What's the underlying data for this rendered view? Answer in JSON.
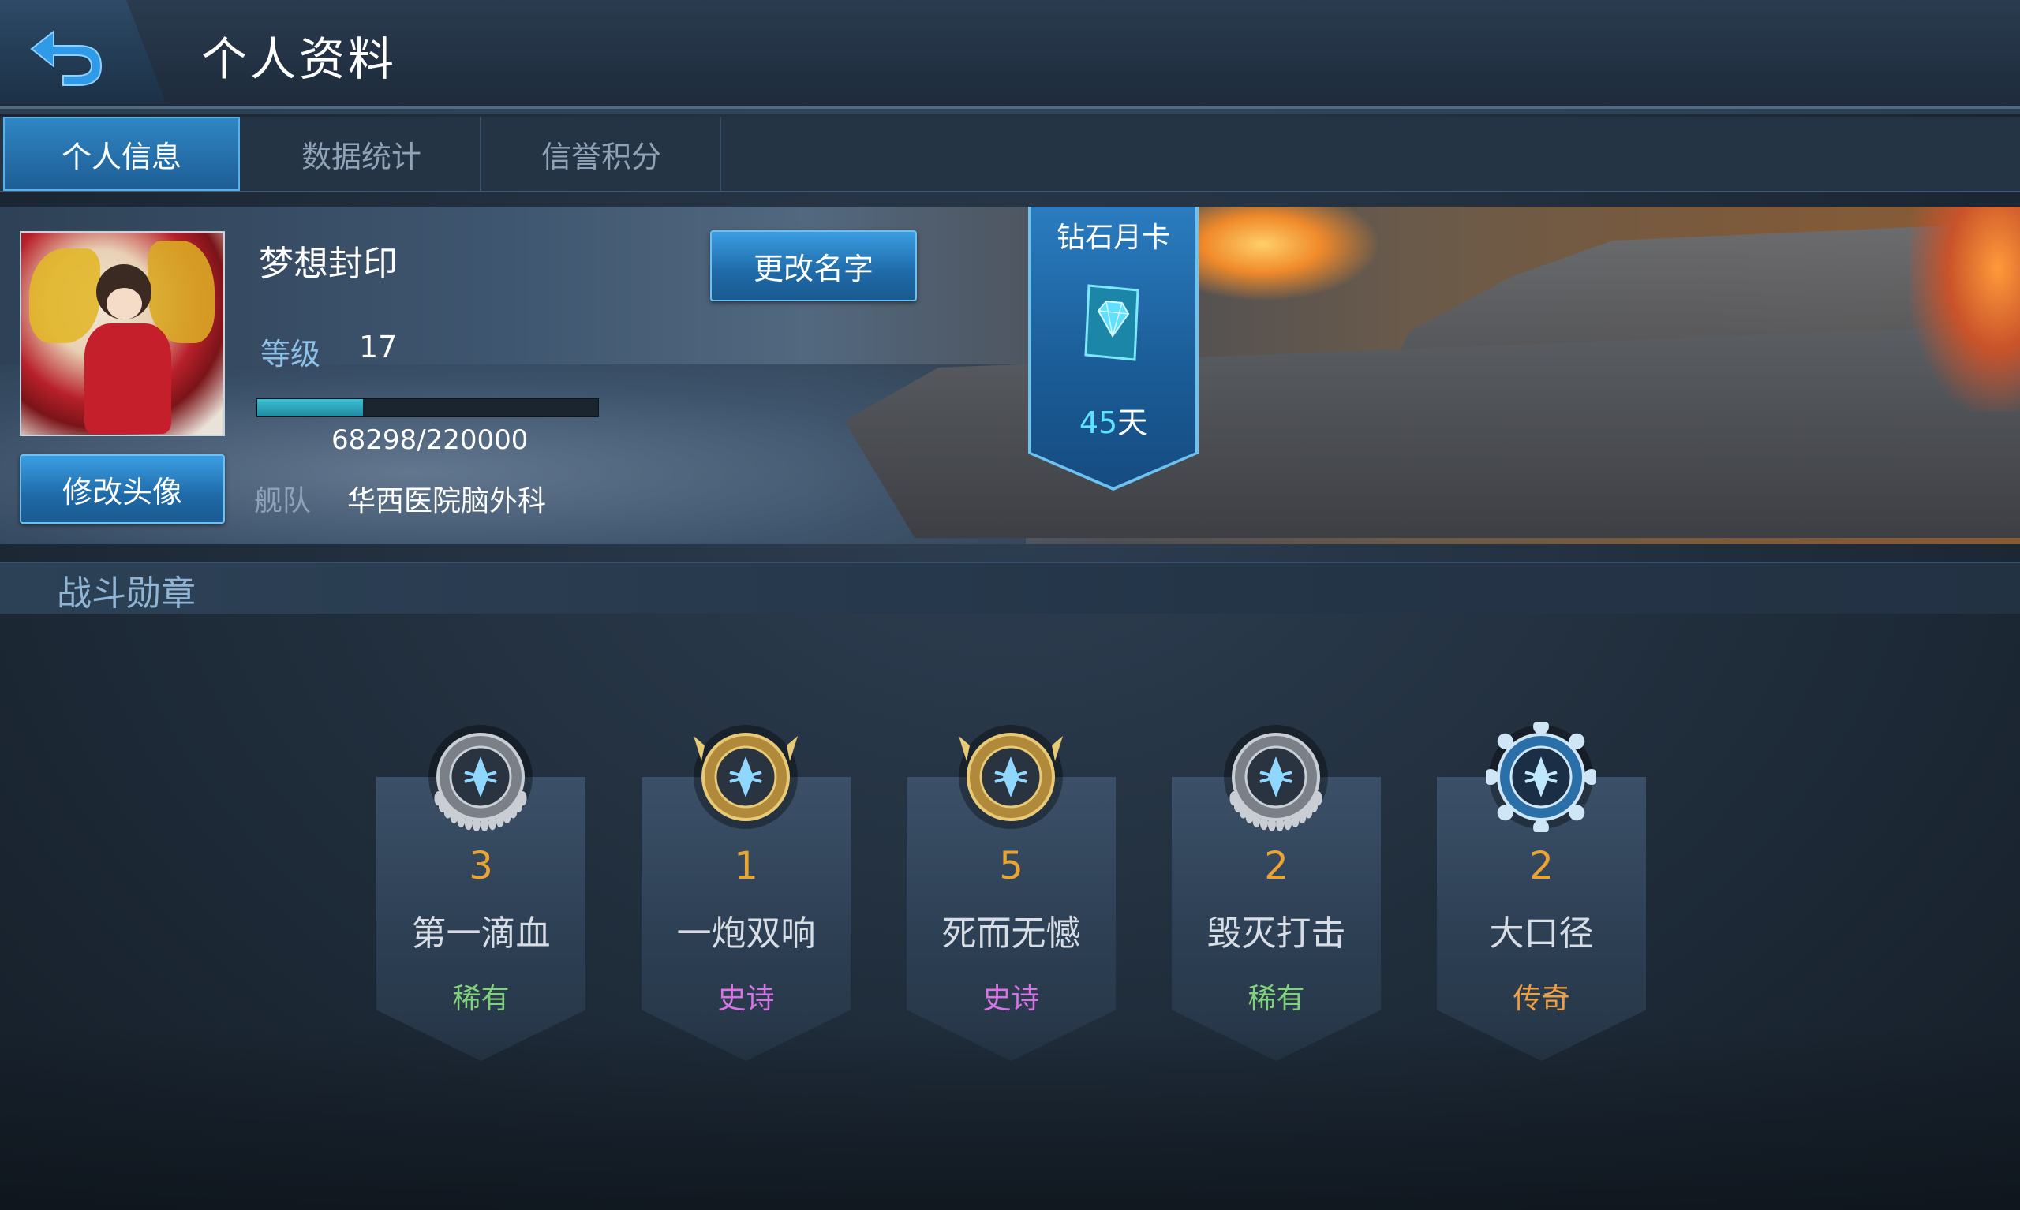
{
  "header": {
    "title": "个人资料",
    "back_icon": "back-arrow-icon"
  },
  "tabs": [
    {
      "label": "个人信息",
      "active": true
    },
    {
      "label": "数据统计",
      "active": false
    },
    {
      "label": "信誉积分",
      "active": false
    }
  ],
  "profile": {
    "username": "梦想封印",
    "rename_label": "更改名字",
    "edit_avatar_label": "修改头像",
    "level_label": "等级",
    "level": "17",
    "xp_text": "68298/220000",
    "xp_fraction": 0.31,
    "fleet_label": "舰队",
    "fleet_name": "华西医院脑外科"
  },
  "diamond_card": {
    "title": "钻石月卡",
    "days": "45",
    "unit": "天",
    "icon": "diamond-card-icon"
  },
  "medals_section": {
    "title": "战斗勋章",
    "items": [
      {
        "count": "3",
        "name": "第一滴血",
        "rarity": "稀有",
        "rarity_color": "#7fd27a",
        "icon": "first-blood-medal-icon",
        "style": "silver"
      },
      {
        "count": "1",
        "name": "一炮双响",
        "rarity": "史诗",
        "rarity_color": "#d873e6",
        "icon": "double-shot-medal-icon",
        "style": "gold"
      },
      {
        "count": "5",
        "name": "死而无憾",
        "rarity": "史诗",
        "rarity_color": "#d873e6",
        "icon": "no-regret-medal-icon",
        "style": "gold"
      },
      {
        "count": "2",
        "name": "毁灭打击",
        "rarity": "稀有",
        "rarity_color": "#7fd27a",
        "icon": "destruction-strike-medal-icon",
        "style": "silver"
      },
      {
        "count": "2",
        "name": "大口径",
        "rarity": "传奇",
        "rarity_color": "#f0a040",
        "icon": "large-caliber-medal-icon",
        "style": "blue"
      }
    ]
  }
}
